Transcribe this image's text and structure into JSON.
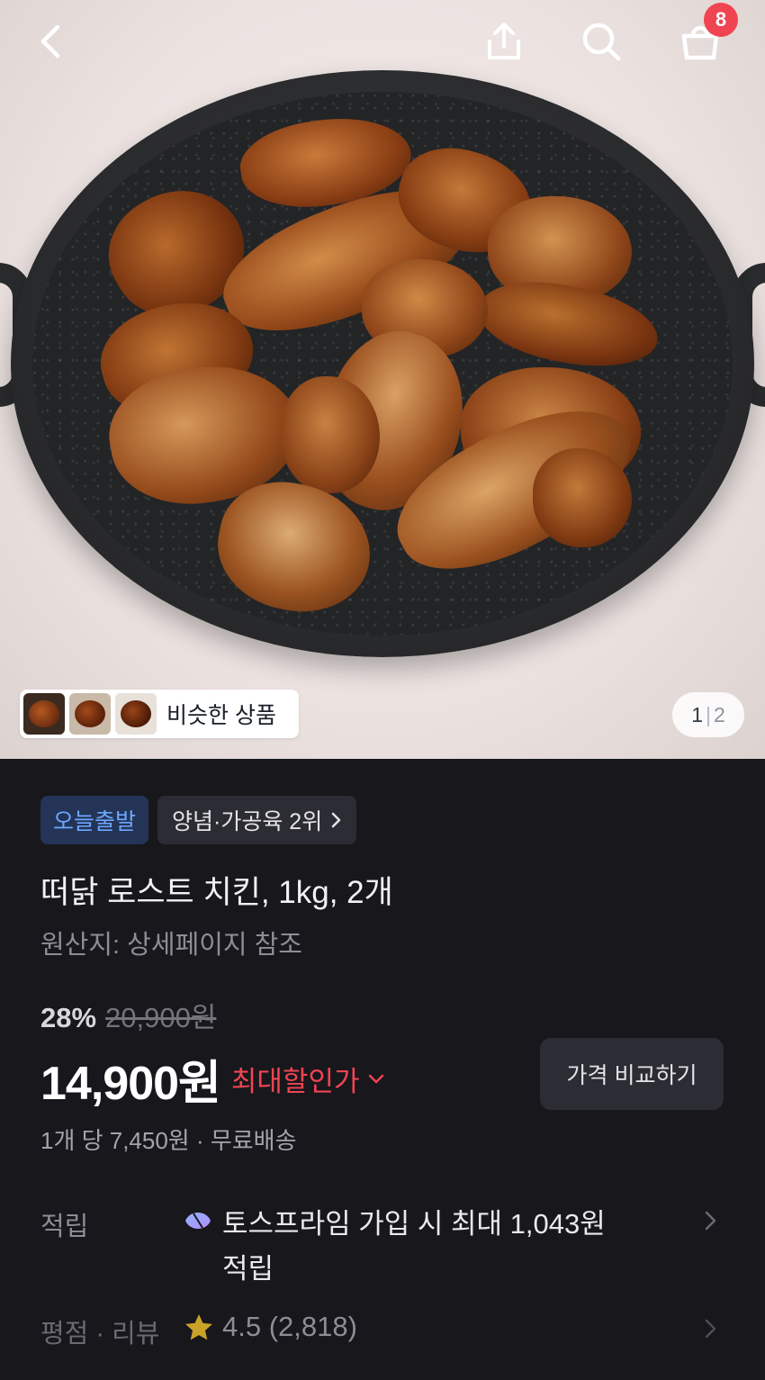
{
  "header": {
    "back_icon": "chevron-left-icon",
    "share_icon": "share-icon",
    "search_icon": "search-icon",
    "cart_icon": "shopping-bag-icon",
    "cart_count": "8"
  },
  "gallery": {
    "similar_label": "비슷한 상품",
    "page_current": "1",
    "page_separator": "|",
    "page_total": "2"
  },
  "product": {
    "badge_departure": "오늘출발",
    "badge_rank": "양념·가공육 2위",
    "title": "떠닭 로스트 치킨, 1kg, 2개",
    "origin": "원산지: 상세페이지 참조",
    "discount_rate": "28%",
    "original_price": "20,900원",
    "price": "14,900원",
    "max_discount_label": "최대할인가",
    "compare_button": "가격 비교하기",
    "unit_price_info": "1개 당 7,450원 · 무료배송"
  },
  "points": {
    "label": "적립",
    "text": "토스프라임 가입 시 최대 1,043원 적립"
  },
  "rating": {
    "label": "평점 · 리뷰",
    "value": "4.5 (2,818)"
  },
  "colors": {
    "background": "#17171c",
    "accent_red": "#f04452",
    "accent_blue": "#6ea6ff",
    "chip_bg": "#2c2c34"
  }
}
